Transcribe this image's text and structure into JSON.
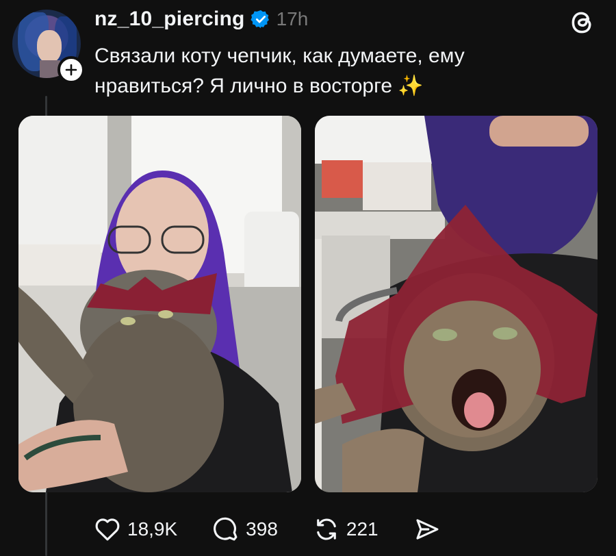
{
  "post": {
    "username": "nz_10_piercing",
    "time": "17h",
    "text": "Связали коту чепчик, как думаете, ему нравиться? Я лично в восторге ✨",
    "verified": true
  },
  "actions": {
    "likes": "18,9K",
    "replies": "398",
    "reposts": "221"
  },
  "icons": {
    "follow": "plus-icon",
    "verified": "verified-badge-icon",
    "app": "threads-logo-icon",
    "like": "heart-icon",
    "reply": "comment-icon",
    "repost": "repost-icon",
    "share": "send-icon"
  },
  "colors": {
    "background": "#101010",
    "text": "#f3f5f7",
    "muted": "#7a7a7a",
    "verified": "#0095f6"
  }
}
